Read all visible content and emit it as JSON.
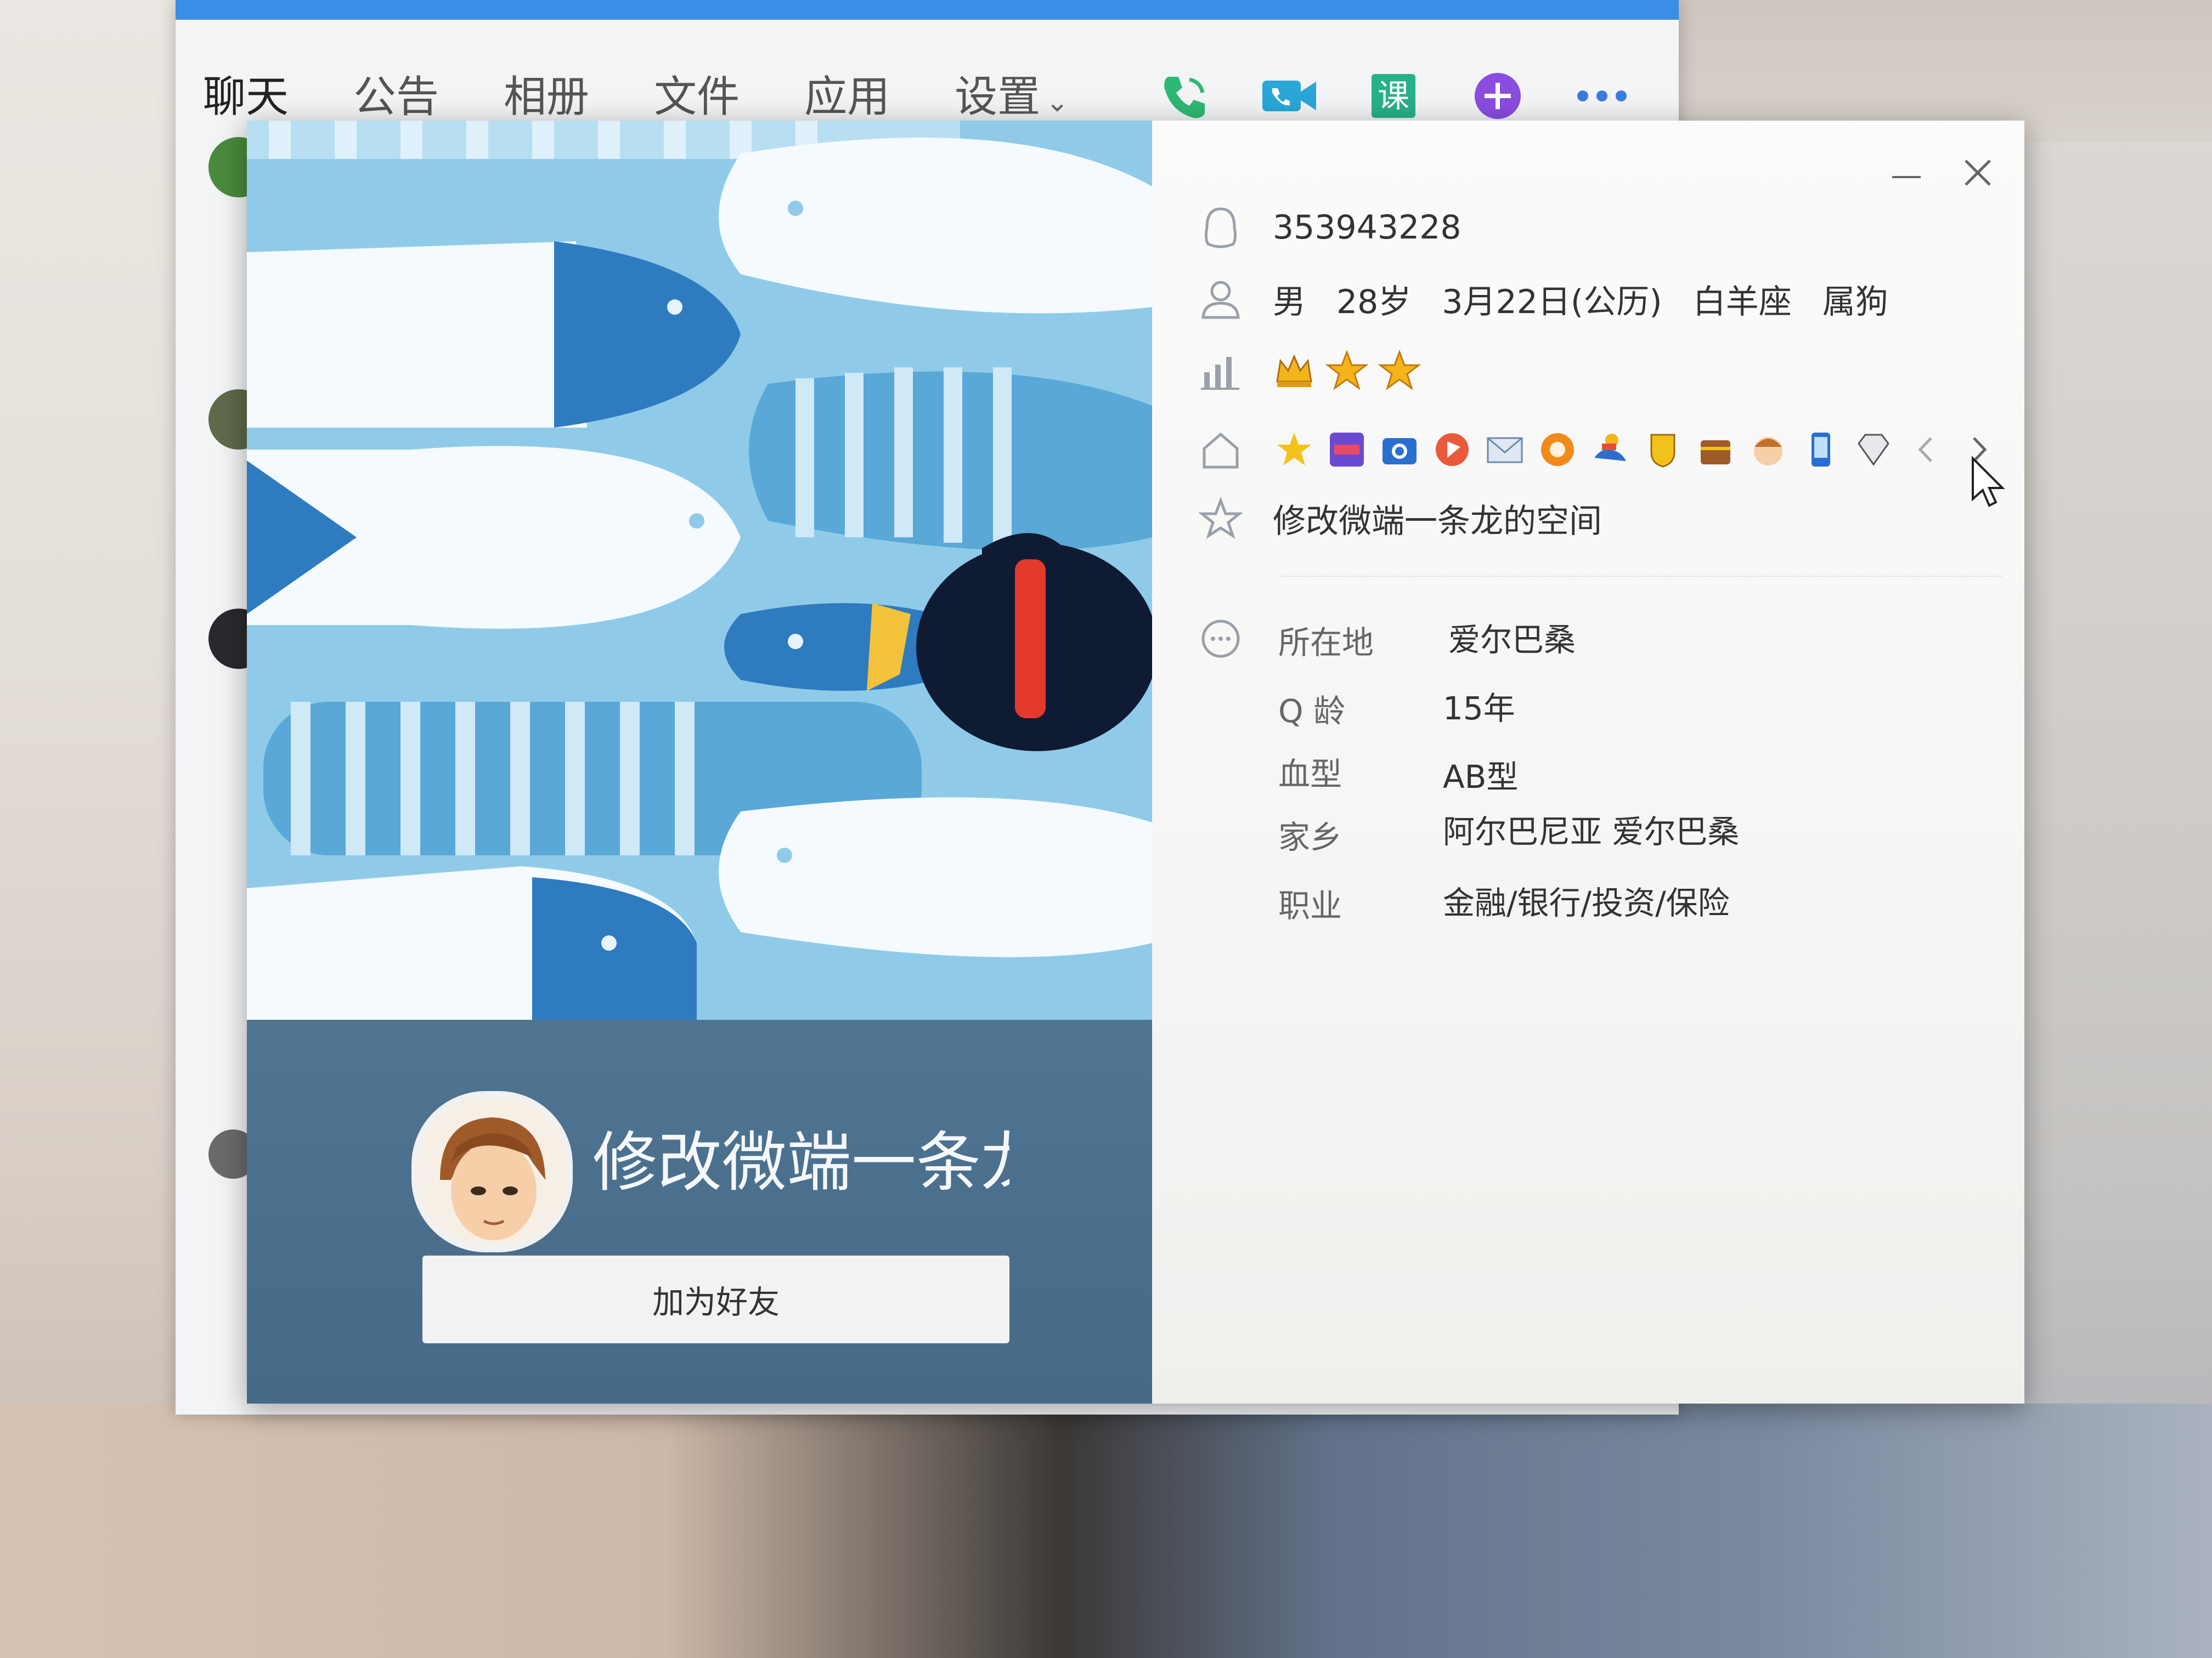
{
  "chat_window": {
    "tabs": [
      "聊天",
      "公告",
      "相册",
      "文件",
      "应用",
      "设置"
    ],
    "tools": [
      "phone-icon",
      "video-icon",
      "lesson-icon",
      "add-icon",
      "more-icon"
    ],
    "lesson_label": "课"
  },
  "profile": {
    "nickname": "修改微端一条龙",
    "add_friend_label": "加为好友",
    "qq_number": "353943228",
    "basic": [
      "男",
      "28岁",
      "3月22日(公历)",
      "白羊座",
      "属狗"
    ],
    "level_icons": [
      "crown-icon",
      "star-icon",
      "star-icon"
    ],
    "service_icons": [
      "star-icon",
      "app-icon",
      "camera-icon",
      "music-icon",
      "mail-icon",
      "game-icon",
      "swim-icon",
      "shield-icon",
      "chest-icon",
      "face-icon",
      "phone-icon",
      "diamond-icon"
    ],
    "space_text": "修改微端一条龙的空间",
    "details": [
      {
        "label": "所在地",
        "value": "爱尔巴桑"
      },
      {
        "label": "Q 龄",
        "value": "15年"
      },
      {
        "label": "血型",
        "value": "AB型"
      },
      {
        "label": "家乡",
        "value": "阿尔巴尼亚 爱尔巴桑"
      },
      {
        "label": "职业",
        "value": "金融/银行/投资/保险"
      }
    ]
  },
  "colors": {
    "cover_bg": "#8fcbe8",
    "card_bottom": "#4a6f8d",
    "accent_blue": "#3a8ee6"
  }
}
